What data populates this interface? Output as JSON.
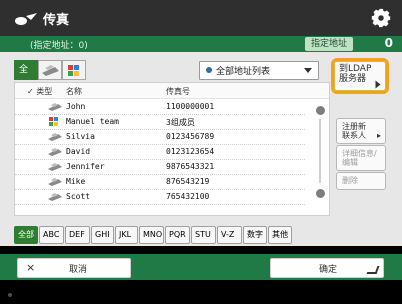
{
  "header": {
    "title": "传真",
    "logo_icon": "fax-logo-icon",
    "gear_icon": "gear-icon"
  },
  "status": {
    "address": "(指定地址：0)",
    "dest_label": "指定地址",
    "count": "0"
  },
  "tabs": {
    "all": "全部",
    "fax_icon": "fax-icon",
    "group_icon": "group-icon"
  },
  "list_filter": {
    "text": "全部地址列表"
  },
  "register_btn": {
    "line1": "到LDAP",
    "line2": "服务器"
  },
  "list": {
    "headers": {
      "check": "✓ 类型",
      "name": "名称",
      "dest": "传真号"
    },
    "rows": [
      {
        "name": "John",
        "dest": "1100000001",
        "icon": "fax-icon"
      },
      {
        "name": "Manuel team",
        "dest": "3组成员",
        "icon": "group-icon"
      },
      {
        "name": "Silvia",
        "dest": "0123456789",
        "icon": "fax-icon"
      },
      {
        "name": "David",
        "dest": "0123123654",
        "icon": "fax-icon"
      },
      {
        "name": "Jennifer",
        "dest": "9876543321",
        "icon": "fax-icon"
      },
      {
        "name": "Mike",
        "dest": "876543219",
        "icon": "fax-icon"
      },
      {
        "name": "Scott",
        "dest": "765432100",
        "icon": "fax-icon"
      }
    ]
  },
  "side": {
    "btn1_line1": "注册新",
    "btn1_line2": "联系人",
    "btn2_line1": "详细信息/",
    "btn2_line2": "编辑",
    "btn3": "删除"
  },
  "index": [
    "全部",
    "ABC",
    "DEF",
    "GHI",
    "JKL",
    "MNO",
    "PQR",
    "STU",
    "V-Z",
    "数字",
    "其他"
  ],
  "footer": {
    "cancel_x": "×",
    "cancel": "取消",
    "ok": "确定"
  }
}
